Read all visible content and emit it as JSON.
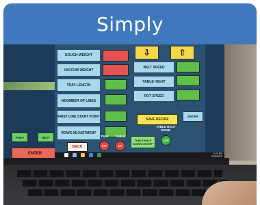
{
  "header": {
    "title": "Simply"
  },
  "panel": {
    "left_labels": [
      "DOUGH WEIGHT",
      "VACCUM WEIGHT",
      "TRAY LENGTH",
      "NOUMBER OF LINES",
      "FRIST LINE START POINT",
      "ROWS ADJUSTMENT"
    ],
    "right_labels": [
      "BELT SPEED",
      "TABLE HIGHT",
      "ROT SPEED"
    ],
    "prev": "PREV",
    "next": "NEXT",
    "enter": "ENTER",
    "save_recipe": "SAVE RECIPE",
    "enter_small": "ENTER",
    "back": "BACK",
    "tray_label": "TRAY",
    "table_label": "TABLE",
    "table_half_down_label": "TABLE HALF DOWN",
    "tray_btn": "OFF",
    "table_btn": "UP",
    "table_half_btn": "TABLE HALF DOWN ON/OFF",
    "half_down_btn": "OFF",
    "time": "6:25 PM",
    "date": "8/10/2022"
  },
  "colors": {
    "header_bg": "#3f78bd",
    "indicator_red": "#e65252",
    "indicator_green": "#5fbf4a",
    "label_bg": "#a8d8ea"
  },
  "icons": [
    "arrow-down-icon",
    "arrow-up-icon",
    "windows-taskbar-icons"
  ]
}
